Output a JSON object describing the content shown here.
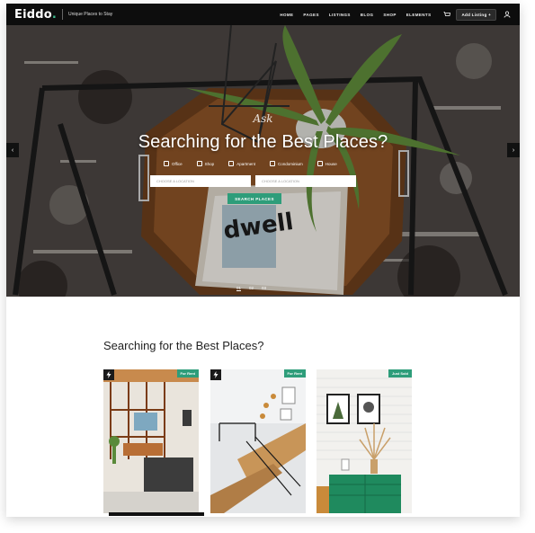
{
  "header": {
    "logo": "Eiddo",
    "logo_dot": ".",
    "tagline": "Unique Places to Stay",
    "nav": [
      "HOME",
      "PAGES",
      "LISTINGS",
      "BLOG",
      "SHOP",
      "ELEMENTS"
    ],
    "add_listing": "Add Listing +",
    "cart_icon": "cart-icon",
    "user_icon": "user-icon"
  },
  "hero": {
    "script_text": "Ask",
    "title": "Searching for the Best Places?",
    "categories": [
      "Office",
      "Shop",
      "Apartment",
      "Condominium",
      "House"
    ],
    "search_left_placeholder": "CHOOSE A LOCATION",
    "search_right_placeholder": "CHOOSE A LOCATION",
    "search_button": "SEARCH PLACES",
    "slides": [
      "01",
      "02",
      "03"
    ],
    "prev_icon": "chevron-left-icon",
    "next_icon": "chevron-right-icon"
  },
  "section": {
    "title": "Searching for the Best Places?",
    "cards": [
      {
        "badge": "For Rent"
      },
      {
        "badge": "For Rent"
      },
      {
        "badge": "Just Sold"
      }
    ]
  },
  "colors": {
    "accent": "#2e9d7a",
    "topbar": "#0d0d0d"
  }
}
